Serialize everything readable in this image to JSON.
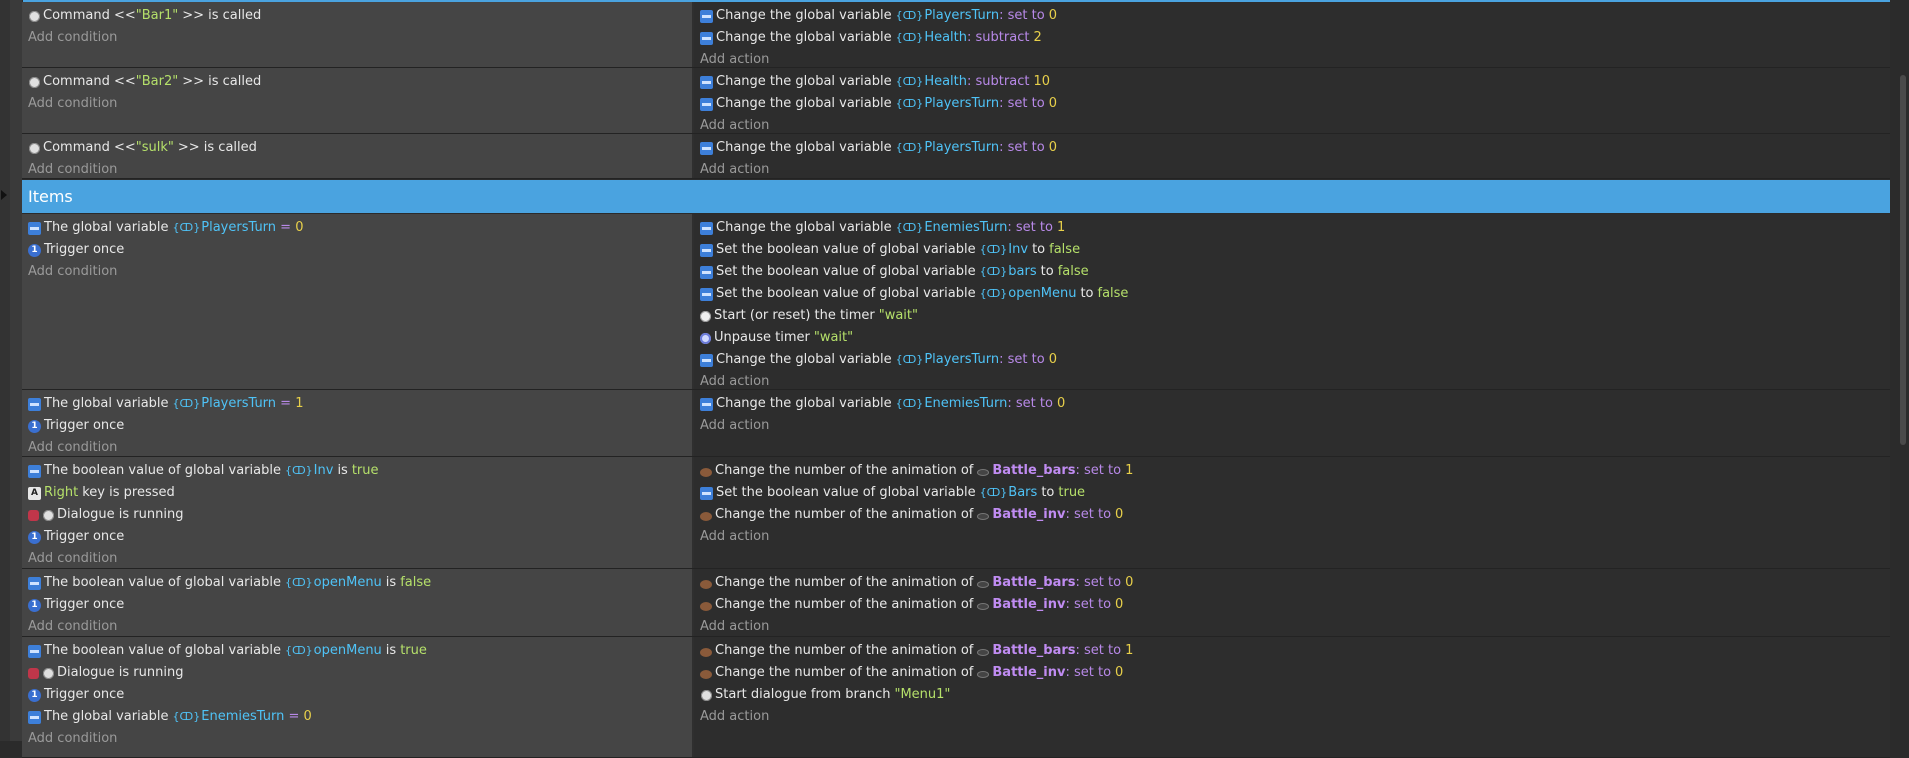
{
  "ui": {
    "add_condition": "Add condition",
    "add_action": "Add action",
    "var_symbol": "{ↀ}"
  },
  "colors": {
    "group_bar": "#4aa3e0",
    "condition_bg": "#454545",
    "action_bg": "#2d2d2d",
    "variable": "#4fc3f7",
    "number": "#e8d04a",
    "string": "#b5e06a",
    "operator": "#b889e8"
  },
  "events": {
    "e1": {
      "cond_prefix": "Command <<",
      "cond_arg": "\"Bar1\"",
      "cond_suffix": ">> is called",
      "a1": {
        "text": "Change the global variable",
        "var": "PlayersTurn",
        "op": ": set to",
        "val": "0"
      },
      "a2": {
        "text": "Change the global variable",
        "var": "Health",
        "op": ": subtract",
        "val": "2"
      }
    },
    "e2": {
      "cond_prefix": "Command <<",
      "cond_arg": "\"Bar2\"",
      "cond_suffix": ">> is called",
      "a1": {
        "text": "Change the global variable",
        "var": "Health",
        "op": ": subtract",
        "val": "10"
      },
      "a2": {
        "text": "Change the global variable",
        "var": "PlayersTurn",
        "op": ": set to",
        "val": "0"
      }
    },
    "e3": {
      "cond_prefix": "Command <<",
      "cond_arg": "\"sulk\"",
      "cond_suffix": ">> is called",
      "a1": {
        "text": "Change the global variable",
        "var": "PlayersTurn",
        "op": ": set to",
        "val": "0"
      }
    },
    "group": {
      "title": "Items"
    },
    "e4": {
      "c1": {
        "text": "The global variable",
        "var": "PlayersTurn",
        "op": " = ",
        "val": "0"
      },
      "c2": "Trigger once",
      "a1": {
        "text": "Change the global variable",
        "var": "EnemiesTurn",
        "op": ": set to",
        "val": "1"
      },
      "a2": {
        "text": "Set the boolean value of global variable",
        "var": "Inv",
        "op": "to",
        "val": "false"
      },
      "a3": {
        "text": "Set the boolean value of global variable",
        "var": "bars",
        "op": "to",
        "val": "false"
      },
      "a4": {
        "text": "Set the boolean value of global variable",
        "var": "openMenu",
        "op": "to",
        "val": "false"
      },
      "a5": {
        "text": "Start (or reset) the timer",
        "val": "\"wait\""
      },
      "a6": {
        "text": "Unpause timer",
        "val": "\"wait\""
      },
      "a7": {
        "text": "Change the global variable",
        "var": "PlayersTurn",
        "op": ": set to",
        "val": "0"
      }
    },
    "e5": {
      "c1": {
        "text": "The global variable",
        "var": "PlayersTurn",
        "op": " = ",
        "val": "1"
      },
      "c2": "Trigger once",
      "a1": {
        "text": "Change the global variable",
        "var": "EnemiesTurn",
        "op": ": set to",
        "val": "0"
      }
    },
    "e6": {
      "c1": {
        "text": "The boolean value of global variable",
        "var": "Inv",
        "op": "is",
        "val": "true"
      },
      "c2": {
        "key": "Right",
        "text": "key is pressed"
      },
      "c3": "Dialogue is running",
      "c4": "Trigger once",
      "a1": {
        "text": "Change the number of the animation of",
        "obj": "Battle_bars",
        "op": ": set to",
        "val": "1"
      },
      "a2": {
        "text": "Set the boolean value of global variable",
        "var": "Bars",
        "op": "to",
        "val": "true"
      },
      "a3": {
        "text": "Change the number of the animation of",
        "obj": "Battle_inv",
        "op": ": set to",
        "val": "0"
      }
    },
    "e7": {
      "c1": {
        "text": "The boolean value of global variable",
        "var": "openMenu",
        "op": "is",
        "val": "false"
      },
      "c2": "Trigger once",
      "a1": {
        "text": "Change the number of the animation of",
        "obj": "Battle_bars",
        "op": ": set to",
        "val": "0"
      },
      "a2": {
        "text": "Change the number of the animation of",
        "obj": "Battle_inv",
        "op": ": set to",
        "val": "0"
      }
    },
    "e8": {
      "c1": {
        "text": "The boolean value of global variable",
        "var": "openMenu",
        "op": "is",
        "val": "true"
      },
      "c2": "Dialogue is running",
      "c3": "Trigger once",
      "c4": {
        "text": "The global variable",
        "var": "EnemiesTurn",
        "op": " = ",
        "val": "0"
      },
      "a1": {
        "text": "Change the number of the animation of",
        "obj": "Battle_bars",
        "op": ": set to",
        "val": "1"
      },
      "a2": {
        "text": "Change the number of the animation of",
        "obj": "Battle_inv",
        "op": ": set to",
        "val": "0"
      },
      "a3": {
        "text": "Start dialogue from branch",
        "val": "\"Menu1\""
      }
    }
  }
}
